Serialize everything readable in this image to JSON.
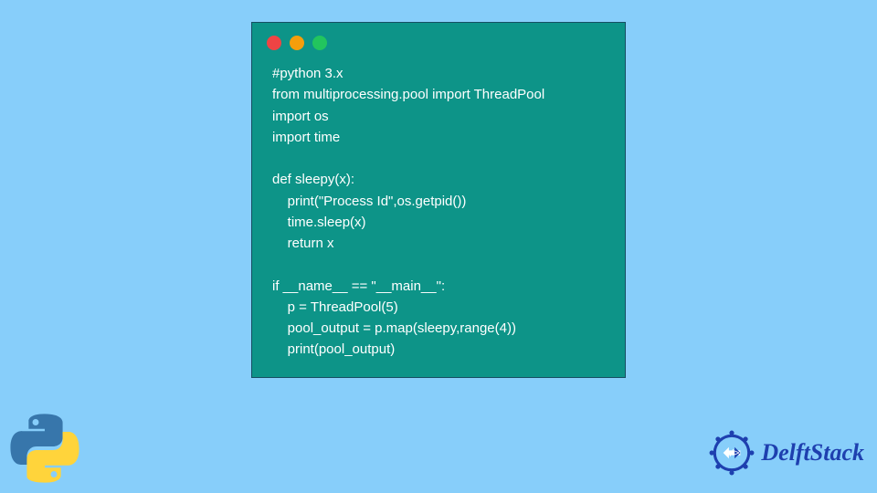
{
  "code": {
    "lines": [
      "#python 3.x",
      "from multiprocessing.pool import ThreadPool",
      "import os",
      "import time",
      "",
      "def sleepy(x):",
      "    print(\"Process Id\",os.getpid())",
      "    time.sleep(x)",
      "    return x",
      "",
      "if __name__ == \"__main__\":",
      "    p = ThreadPool(5)",
      "    pool_output = p.map(sleepy,range(4))",
      "    print(pool_output)"
    ]
  },
  "brand": {
    "name": "DelftStack"
  },
  "icons": {
    "python": "python-logo",
    "brand": "delftstack-gear"
  },
  "colors": {
    "background": "#87cefa",
    "card": "#0d9488",
    "brand_text": "#1e40af"
  }
}
